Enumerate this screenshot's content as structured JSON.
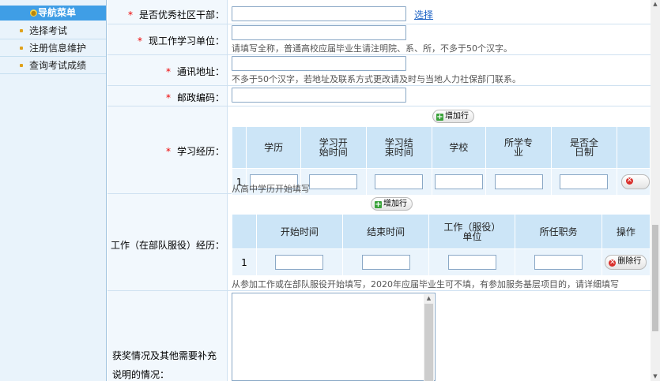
{
  "sidebar": {
    "title": "导航菜单",
    "items": [
      {
        "label": "选择考试"
      },
      {
        "label": "注册信息维护"
      },
      {
        "label": "查询考试成绩"
      }
    ]
  },
  "form": {
    "excellent_cadre": {
      "label": "是否优秀社区干部：",
      "value": "",
      "link": "选择"
    },
    "work_unit": {
      "label": "现工作学习单位：",
      "value": "",
      "hint": "请填写全称，普通高校应届毕业生请注明院、系、所，不多于50个汉字。"
    },
    "address": {
      "label": "通讯地址：",
      "value": "",
      "hint": "不多于50个汉字，若地址及联系方式更改请及时与当地人力社保部门联系。"
    },
    "postcode": {
      "label": "邮政编码：",
      "value": ""
    },
    "study": {
      "label": "学习经历：",
      "add_label": "增加行",
      "columns": [
        "学历",
        "学习开始时间",
        "学习结束时间",
        "学校",
        "所学专业",
        "是否全日制"
      ],
      "rows": [
        {
          "index": "1"
        }
      ],
      "hint": "从高中学历开始填写"
    },
    "work": {
      "label": "工作（在部队服役）经历：",
      "add_label": "增加行",
      "columns": [
        "开始时间",
        "结束时间",
        "工作（服役）单位",
        "所任职务",
        "操作"
      ],
      "rows": [
        {
          "index": "1",
          "delete_label": "删除行"
        }
      ],
      "hint": "从参加工作或在部队服役开始填写，2020年应届毕业生可不填，有参加服务基层项目的，请详细填写"
    },
    "awards": {
      "label": "获奖情况及其他需要补充说明的情况：",
      "value": ""
    }
  }
}
